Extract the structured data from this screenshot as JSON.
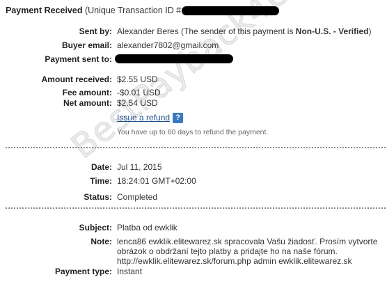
{
  "header": {
    "title_strong": "Payment Received",
    "title_rest": " (Unique Transaction ID #"
  },
  "fields": {
    "sent_by_label": "Sent by:",
    "sent_by_name": "Alexander Beres (The sender of this payment is ",
    "sent_by_status": "Non-U.S. - Verified",
    "sent_by_close": ")",
    "buyer_email_label": "Buyer email:",
    "buyer_email": "alexander7802@gmail.com",
    "payment_sent_to_label": "Payment sent to:"
  },
  "amounts": {
    "amount_received_label": "Amount received:",
    "amount_received": "$2.55 USD",
    "fee_label": "Fee amount:",
    "fee": "-$0.01 USD",
    "net_label": "Net amount:",
    "net": "$2.54 USD",
    "refund_link": "Issue a refund",
    "refund_help_icon": "?",
    "refund_note": "You have up to 60 days to refund the payment."
  },
  "details": {
    "date_label": "Date:",
    "date": "Jul 11, 2015",
    "time_label": "Time:",
    "time": "18:24:01 GMT+02:00",
    "status_label": "Status:",
    "status": "Completed"
  },
  "message": {
    "subject_label": "Subject:",
    "subject": "Platba od ewklik",
    "note_label": "Note:",
    "note_line1": "lenca86 ewklik.elitewarez.sk spracovala Vašu žiadosť. Prosím vytvorte",
    "note_line2": "obrázok o obdržaní tejto platby a pridajte ho na naše fórum.",
    "note_line3": "http://ewklik.elitewarez.sk/forum.php admin ewklik.elitewarez.sk",
    "payment_type_label": "Payment type:",
    "payment_type": "Instant"
  },
  "watermark": "BestPayback4U.com",
  "colors": {
    "link": "#1b4f8b",
    "help_icon": "#3b78c2",
    "redaction": "#000000"
  }
}
